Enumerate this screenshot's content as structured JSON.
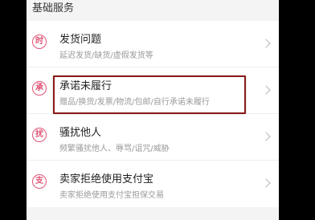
{
  "section": {
    "title": "基础服务"
  },
  "items": [
    {
      "badge": "时",
      "title": "发货问题",
      "subtitle": "延迟发货/缺货/虚假发货等",
      "icon": "chevron-right-icon"
    },
    {
      "badge": "承",
      "title": "承诺未履行",
      "subtitle": "赠品/换货/发票/物流/包邮/自行承诺未履行",
      "icon": "chevron-right-icon"
    },
    {
      "badge": "扰",
      "title": "骚扰他人",
      "subtitle": "频繁骚扰他人、辱骂/诅咒/威胁",
      "icon": "chevron-right-icon"
    },
    {
      "badge": "支",
      "title": "卖家拒绝使用支付宝",
      "subtitle": "卖家拒绝使用支付宝担保交易",
      "icon": "chevron-right-icon"
    }
  ],
  "colors": {
    "badge": "#e05576",
    "highlight": "#8b1a1a",
    "background": "#f4f4f4"
  }
}
